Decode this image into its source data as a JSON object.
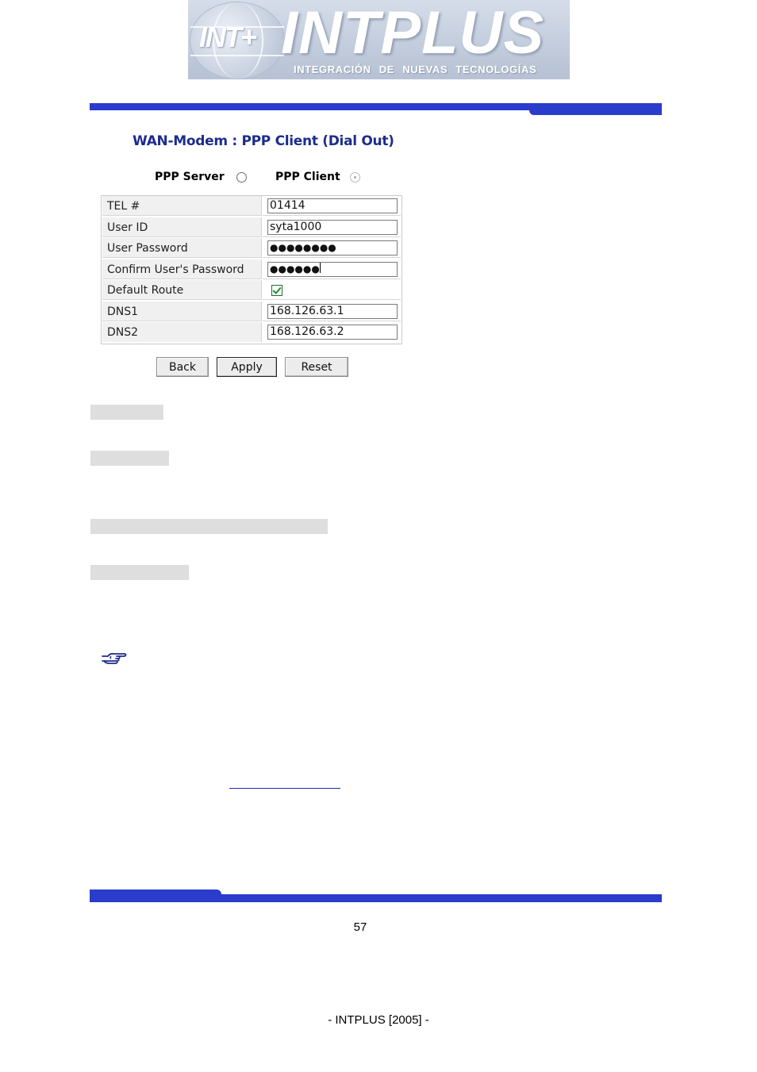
{
  "logo": {
    "brand": "INTPLUS",
    "mark": "INT+",
    "tagline": "INTEGRACIÓN DE NUEVAS TECNOLOGÍAS"
  },
  "screen": {
    "title": "WAN-Modem : PPP Client (Dial Out)",
    "mode": {
      "server_label": "PPP Server",
      "client_label": "PPP Client",
      "selected": "PPP Client"
    },
    "fields": {
      "tel": {
        "label": "TEL #",
        "value": "01414"
      },
      "user_id": {
        "label": "User ID",
        "value": "syta1000"
      },
      "password": {
        "label": "User Password",
        "value": "●●●●●●●●"
      },
      "confirm": {
        "label": "Confirm User's Password",
        "value": "●●●●●●"
      },
      "default_route": {
        "label": "Default Route",
        "checked": true
      },
      "dns1": {
        "label": "DNS1",
        "value": "168.126.63.1"
      },
      "dns2": {
        "label": "DNS2",
        "value": "168.126.63.2"
      }
    },
    "buttons": {
      "back": "Back",
      "apply": "Apply",
      "reset": "Reset"
    }
  },
  "colors": {
    "rule": "#2a3ccc",
    "title": "#1d2c8c"
  },
  "page_number": "57",
  "footer": "- INTPLUS [2005] -"
}
